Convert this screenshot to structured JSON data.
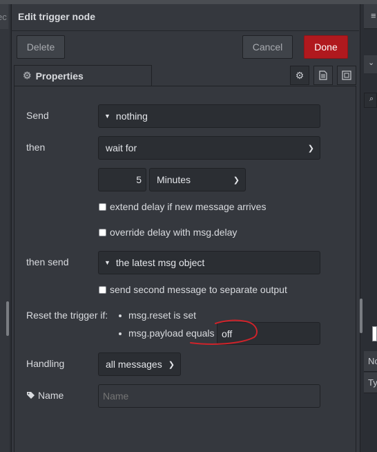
{
  "dialog": {
    "title": "Edit trigger node"
  },
  "buttons": {
    "delete": "Delete",
    "cancel": "Cancel",
    "done": "Done"
  },
  "tabs": {
    "properties": "Properties"
  },
  "form": {
    "send_label": "Send",
    "send_value": "nothing",
    "then_label": "then",
    "then_value": "wait for",
    "duration_value": "5",
    "duration_unit": "Minutes",
    "extend_delay": "extend delay if new message arrives",
    "override_delay": "override delay with msg.delay",
    "then_send_label": "then send",
    "then_send_value": "the latest msg object",
    "second_output": "send second message to separate output",
    "reset_label": "Reset the trigger if:",
    "reset_cond1": "msg.reset is set",
    "reset_cond2": "msg.payload equals",
    "reset_payload_value": "off",
    "handling_label": "Handling",
    "handling_value": "all messages",
    "name_label": "Name",
    "name_placeholder": "Name"
  },
  "side": {
    "left_tab_fragment": "ec",
    "right_row1": "No",
    "right_row2": "Ty"
  },
  "colors": {
    "accent_done": "#b0191e",
    "annotation": "#d0232a"
  }
}
